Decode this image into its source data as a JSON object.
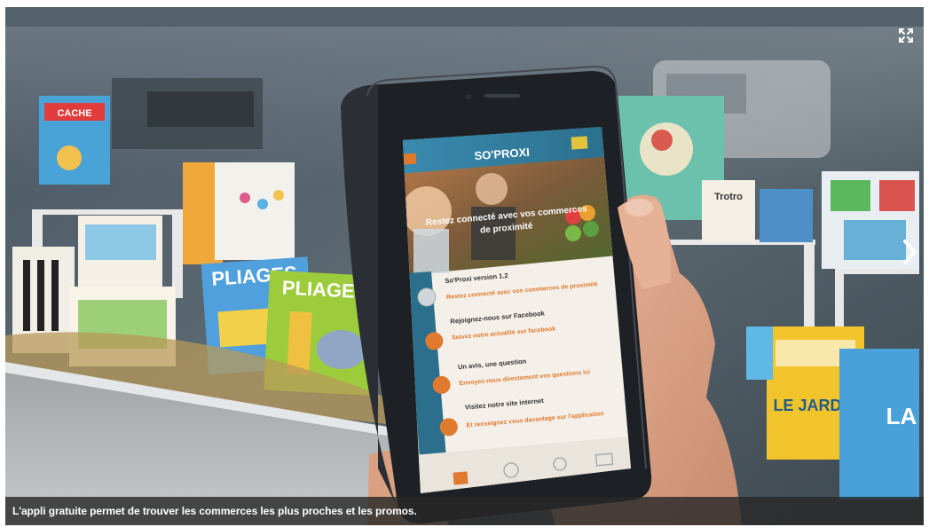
{
  "caption": "L'appli gratuite permet de trouver les commerces les plus proches et les promos.",
  "controls": {
    "fullscreen_icon": "expand-arrows-icon",
    "next_icon": "chevron-right-icon"
  },
  "phone_app": {
    "brand": "SO'PROXI",
    "hero_text_line1": "Restez connecté avec vos commerces",
    "hero_text_line2": "de proximité",
    "menu_items": [
      {
        "title": "So'Proxi version 1.2",
        "subtitle": "Restez connecté avec vos commerces de proximité"
      },
      {
        "title": "Rejoignez-nous sur Facebook",
        "subtitle": "Suivez notre actualité sur facebook"
      },
      {
        "title": "Un avis, une question",
        "subtitle": "Envoyez-nous directement vos questions ici"
      },
      {
        "title": "Visitez notre site internet",
        "subtitle": "Et renseignez vous davantage sur l'application"
      }
    ]
  },
  "colors": {
    "app_accent": "#e07a2e",
    "app_header": "#2b6f8c",
    "caption_bg": "#282828"
  }
}
